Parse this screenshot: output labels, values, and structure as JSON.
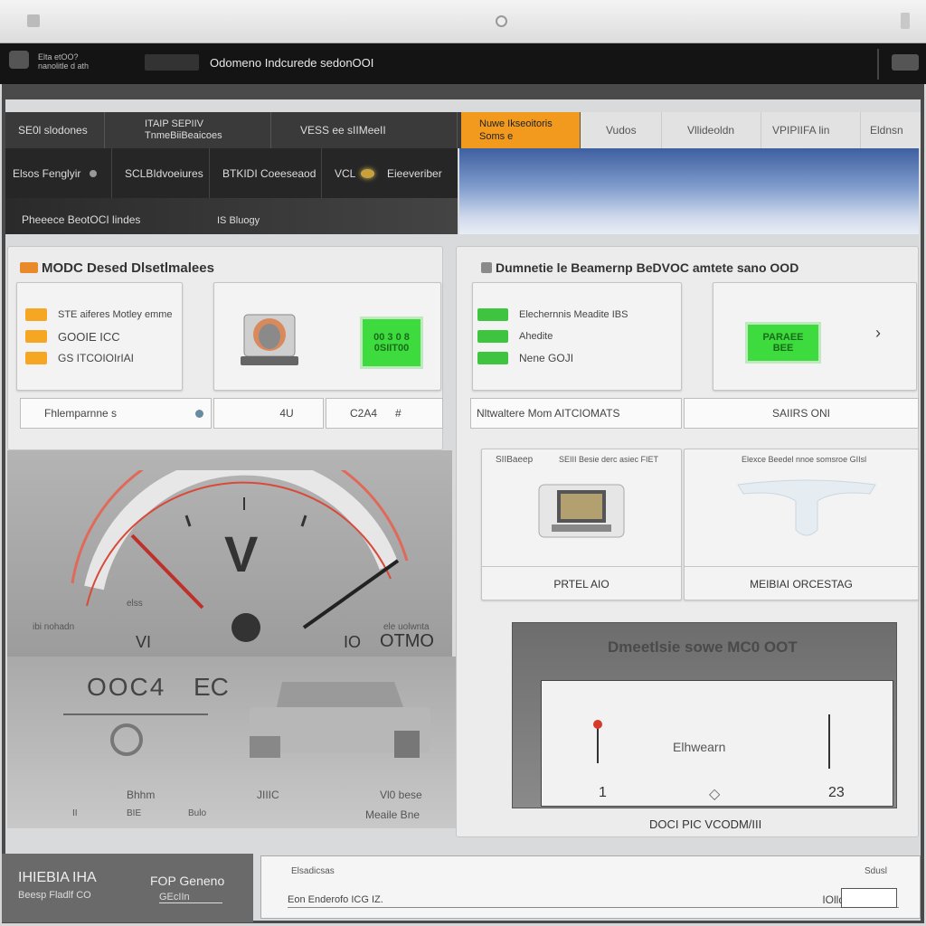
{
  "window": {
    "title": ""
  },
  "app": {
    "subtitle": "Elta etOO?\nnanolitle d ath",
    "title": "Odomeno Indcurede sedonOOI"
  },
  "tabs": [
    {
      "label": "SE0l slodones"
    },
    {
      "label": "ITAIP SEPIIV\nTnmeBiiBeaicoes"
    },
    {
      "label": "VESS ee sIIMeeII"
    },
    {
      "label": "Nuwe Ikseoitoris\nSoms e"
    },
    {
      "label": "Vudos"
    },
    {
      "label": "Vllideoldn"
    },
    {
      "label": "VPIPIIFA lin"
    },
    {
      "label": "Eldnsn"
    }
  ],
  "subnav": {
    "items": [
      "Elsos Fenglyir",
      "SCLBIdvoeiures",
      "BTKIDI Coeeseaod",
      "VCL",
      "Eieeveriber"
    ],
    "third_left": "Pheeece BeotOCI lindes",
    "third_right": "IS Bluogy"
  },
  "left_panel": {
    "title": "MODC Desed Dlsetlmalees",
    "rows": [
      "STE aiferes Motley emme",
      "GOOIE ICC",
      "GS ITCOIOIrIAI"
    ],
    "row_colors": [
      "#f5a623",
      "#f5a623",
      "#f5a623"
    ],
    "lcd_lines": [
      "00 3 0 8",
      "0SIIT00"
    ],
    "field1": "Fhlemparnne s",
    "field2": "4U",
    "field3": "C2A4",
    "field3_suffix": "#"
  },
  "right_panel": {
    "title": "Dumnetie le Beamernp BeDVOC amtete sano OOD",
    "rows": [
      "Elechernnis Meadite IBS",
      "Ahedite",
      "Nene GOJI"
    ],
    "row_colors": [
      "#3ec43e",
      "#3ec43e",
      "#3ec43e"
    ],
    "lcd_lines": [
      "PARAEE",
      "BEE"
    ],
    "field_left": "Nltwaltere Mom AITCIOMATS",
    "field_right": "SAIIRS ONI",
    "card_a_label": "SIIBaeep",
    "card_a_label2": "SEIII Besie derc asiec FIET",
    "card_a_footer": "PRTEL AIO",
    "card_b_label": "Elexce Beedel nnoe somsroe GIIsl",
    "card_b_footer": "MEIBIAI ORCESTAG"
  },
  "gauge": {
    "center_label": "V",
    "bottom_labels": [
      "VI",
      "IO",
      "OTMO"
    ],
    "left_tick": "elss",
    "left_small": "ibi nohadn",
    "right_small": "ele uolwnta"
  },
  "lower_left": {
    "big_left": "OOC4",
    "big_right": "EC",
    "labels": [
      "Bhhm",
      "JIIIC",
      "Vl0 bese"
    ],
    "bottom": [
      "II",
      "BIE",
      "Bulo",
      "Meaile Bne"
    ]
  },
  "chart": {
    "header": "Dmeetlsie sowe MC0 OOT",
    "mid_label": "Elhwearn",
    "left_num": "1",
    "right_num": "23",
    "caption": "DOCI PIC VCODM/III"
  },
  "footer": {
    "left_title": "IHIEBIA",
    "left_title2": "IHA",
    "left_sub": "Beesp Fladlf CO",
    "left_right_title": "FOP Geneno",
    "left_right_sub": "GEcIIn",
    "right_top_left": "Elsadicsas",
    "right_top_right": "Sdusl",
    "right_bottom_left": "Eon Enderofo ICG IZ.",
    "right_bottom_right": "IOlld"
  }
}
